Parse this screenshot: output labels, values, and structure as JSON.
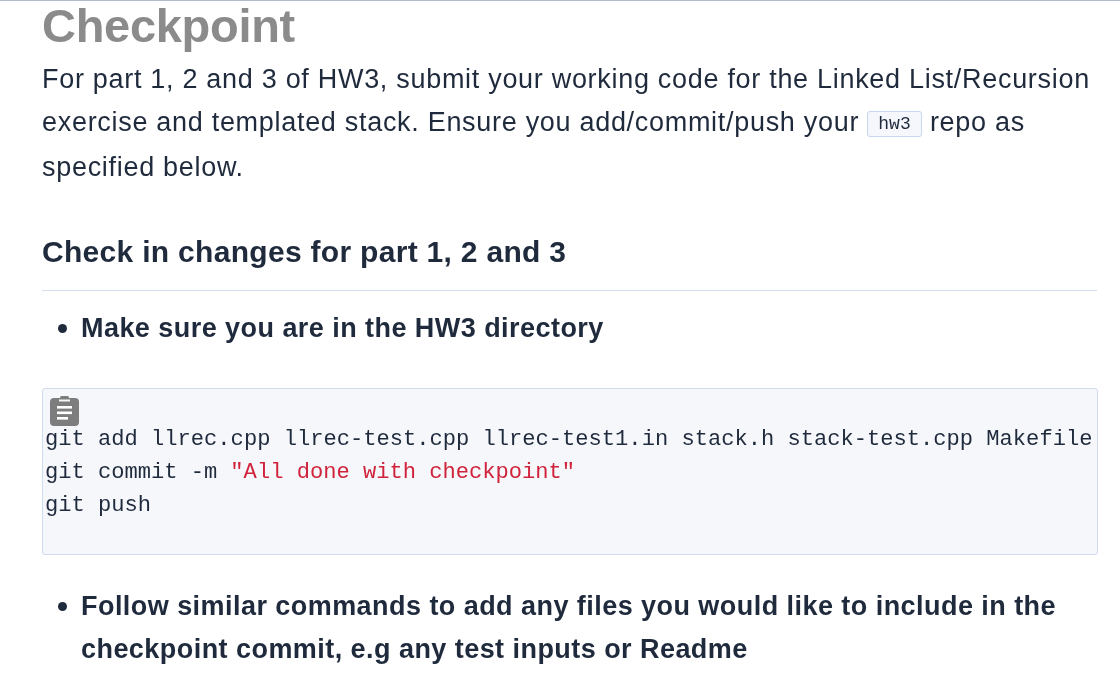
{
  "title": "Checkpoint",
  "intro": {
    "before": "For part 1, 2 and 3 of HW3, submit your working code for the Linked List/Recursion exercise and templated stack. Ensure you add/commit/push your",
    "code": "hw3",
    "after": "repo as specified below."
  },
  "section": {
    "heading": "Check in changes for part 1, 2 and 3",
    "steps": [
      {
        "kind": "bullet",
        "text": "Make sure you are in the HW3 directory"
      },
      {
        "kind": "code",
        "lines": [
          {
            "segments": [
              {
                "kind": "plain",
                "text": "git add llrec.cpp llrec-test.cpp llrec-test1.in stack.h stack-test.cpp Makefile"
              }
            ]
          },
          {
            "segments": [
              {
                "kind": "plain",
                "text": "git commit -m"
              },
              {
                "kind": "string",
                "text": "\"All done with checkpoint\""
              }
            ]
          },
          {
            "segments": [
              {
                "kind": "plain",
                "text": "git push"
              }
            ]
          }
        ]
      },
      {
        "kind": "bullet",
        "text": "Follow similar commands to add any files you would like to include in the checkpoint commit, e.g any test inputs or Readme"
      }
    ]
  }
}
